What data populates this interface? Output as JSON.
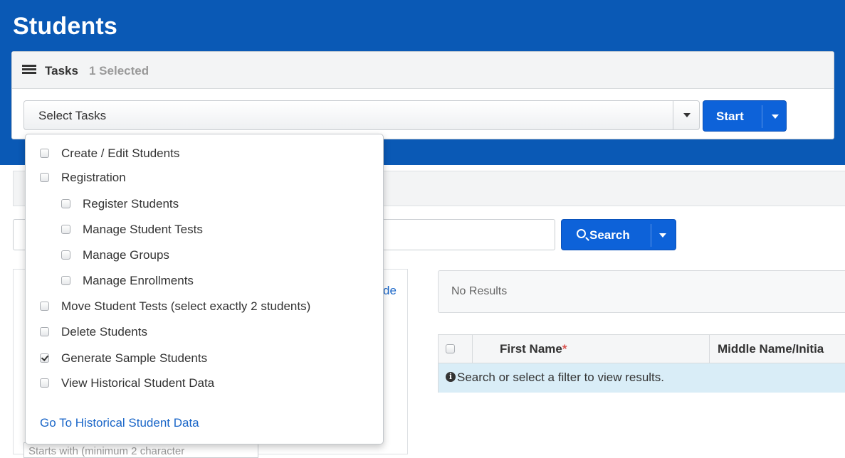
{
  "page": {
    "title": "Students"
  },
  "tasks": {
    "label": "Tasks",
    "selected_count": "1 Selected",
    "select_placeholder": "Select Tasks",
    "start_label": "Start",
    "options": [
      {
        "label": "Create / Edit Students",
        "checked": false
      },
      {
        "label": "Registration",
        "checked": false
      },
      {
        "label": "Register Students",
        "checked": false
      },
      {
        "label": "Manage Student Tests",
        "checked": false
      },
      {
        "label": "Manage Groups",
        "checked": false
      },
      {
        "label": "Manage Enrollments",
        "checked": false
      },
      {
        "label": "Move Student Tests (select exactly 2 students)",
        "checked": false
      },
      {
        "label": "Delete Students",
        "checked": false
      },
      {
        "label": "Generate Sample Students",
        "checked": true
      },
      {
        "label": "View Historical Student Data",
        "checked": false
      }
    ],
    "historical_link": "Go To Historical Student Data"
  },
  "search": {
    "button_label": "Search"
  },
  "filters": {
    "hide_link_fragment": "de",
    "starts_with_placeholder": "Starts with (minimum 2 character"
  },
  "results": {
    "status": "No Results"
  },
  "table": {
    "columns": [
      "First Name",
      "Middle Name/Initia"
    ],
    "required_marker": "*",
    "info_message": "Search or select a filter to view results."
  },
  "colors": {
    "header_blue": "#0a59b5",
    "button_blue": "#0d62d9",
    "link_blue": "#1a66c8",
    "info_bg": "#d9edf7",
    "required_red": "#d9534f"
  }
}
